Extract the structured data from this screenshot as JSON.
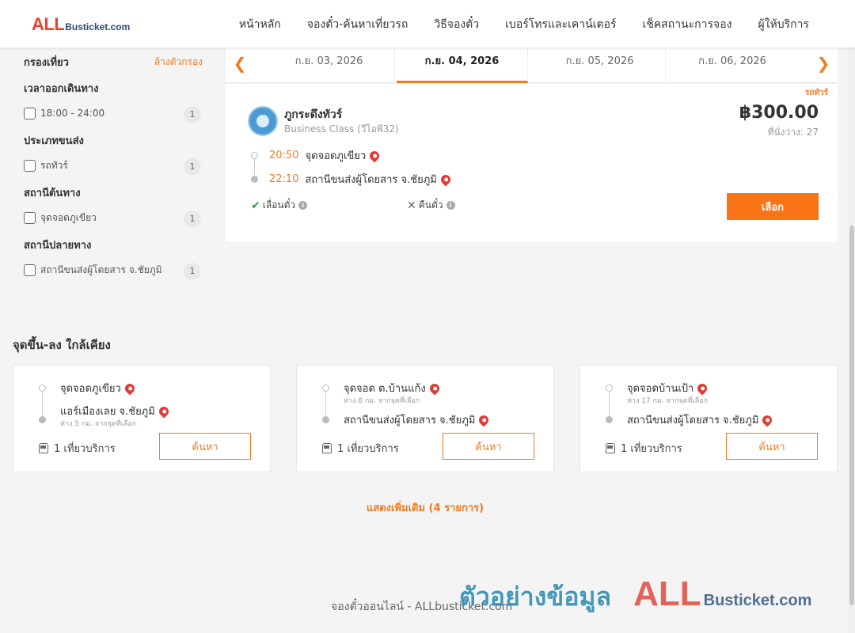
{
  "header": {
    "logo_main": "ALL",
    "logo_sub": "Busticket.com",
    "nav": [
      "หน้าหลัก",
      "จองตั๋ว-ค้นหาเที่ยวรถ",
      "วิธีจองตั๋ว",
      "เบอร์โทรและเคาน์เตอร์",
      "เช็คสถานะการจอง",
      "ผู้ให้บริการ"
    ]
  },
  "filters": {
    "title": "กรองเที่ยว",
    "clear_label": "ล้างตัวกรอง",
    "groups": [
      {
        "title": "เวลาออกเดินทาง",
        "option": "18:00 - 24:00",
        "count": "1"
      },
      {
        "title": "ประเภทขนส่ง",
        "option": "รถทัวร์",
        "count": "1"
      },
      {
        "title": "สถานีต้นทาง",
        "option": "จุดจอดภูเขียว",
        "count": "1"
      },
      {
        "title": "สถานีปลายทาง",
        "option": "สถานีขนส่งผู้โดยสาร จ.ชัยภูมิ",
        "count": "1"
      }
    ]
  },
  "dates": {
    "prev_icon": "chevron-left-icon",
    "next_icon": "chevron-right-icon",
    "tabs": [
      "ก.ย. 03, 2026",
      "ก.ย. 04, 2026",
      "ก.ย. 05, 2026",
      "ก.ย. 06, 2026"
    ],
    "active_index": 1
  },
  "trip": {
    "badge": "รถทัวร์",
    "company": "ภูกระดึงทัวร์",
    "class": "Business Class (วีไอพี32)",
    "price": "฿300.00",
    "seats": "ที่นั่งว่าง: 27",
    "depart_time": "20:50",
    "depart_stop": "จุดจอดภูเขียว",
    "arrive_time": "22:10",
    "arrive_stop": "สถานีขนส่งผู้โดยสาร จ.ชัยภูมิ",
    "feature_reschedule": "เลื่อนตั๋ว",
    "feature_refund": "คืนตั๋ว",
    "select_label": "เลือก"
  },
  "nearby": {
    "title": "จุดขึ้น-ลง ใกล้เคียง",
    "cards": [
      {
        "from": "จุดจอดภูเขียว",
        "from_note": "",
        "to": "แอร์เมืองเลย จ.ชัยภูมิ",
        "to_note": "ห่าง 5 กม. จากจุดที่เลือก",
        "trips": "1 เที่ยวบริการ",
        "button": "ค้นหา"
      },
      {
        "from": "จุดจอด ต.บ้านแก้ง",
        "from_note": "ห่าง 8 กม. จากจุดที่เลือก",
        "to": "สถานีขนส่งผู้โดยสาร จ.ชัยภูมิ",
        "to_note": "",
        "trips": "1 เที่ยวบริการ",
        "button": "ค้นหา"
      },
      {
        "from": "จุดจอดบ้านเป้า",
        "from_note": "ห่าง 17 กม. จากจุดที่เลือก",
        "to": "สถานีขนส่งผู้โดยสาร จ.ชัยภูมิ",
        "to_note": "",
        "trips": "1 เที่ยวบริการ",
        "button": "ค้นหา"
      }
    ],
    "show_more": "แสดงเพิ่มเติม (4 รายการ)"
  },
  "footer": {
    "text": "จองตั๋วออนไลน์ - ALLbusticket.com"
  },
  "watermark": {
    "text": "ตัวอย่างข้อมูล",
    "logo_main": "ALL",
    "logo_sub": "Busticket.com"
  },
  "colors": {
    "accent": "#f47a20",
    "button": "#f97417",
    "pin": "#e53935"
  }
}
